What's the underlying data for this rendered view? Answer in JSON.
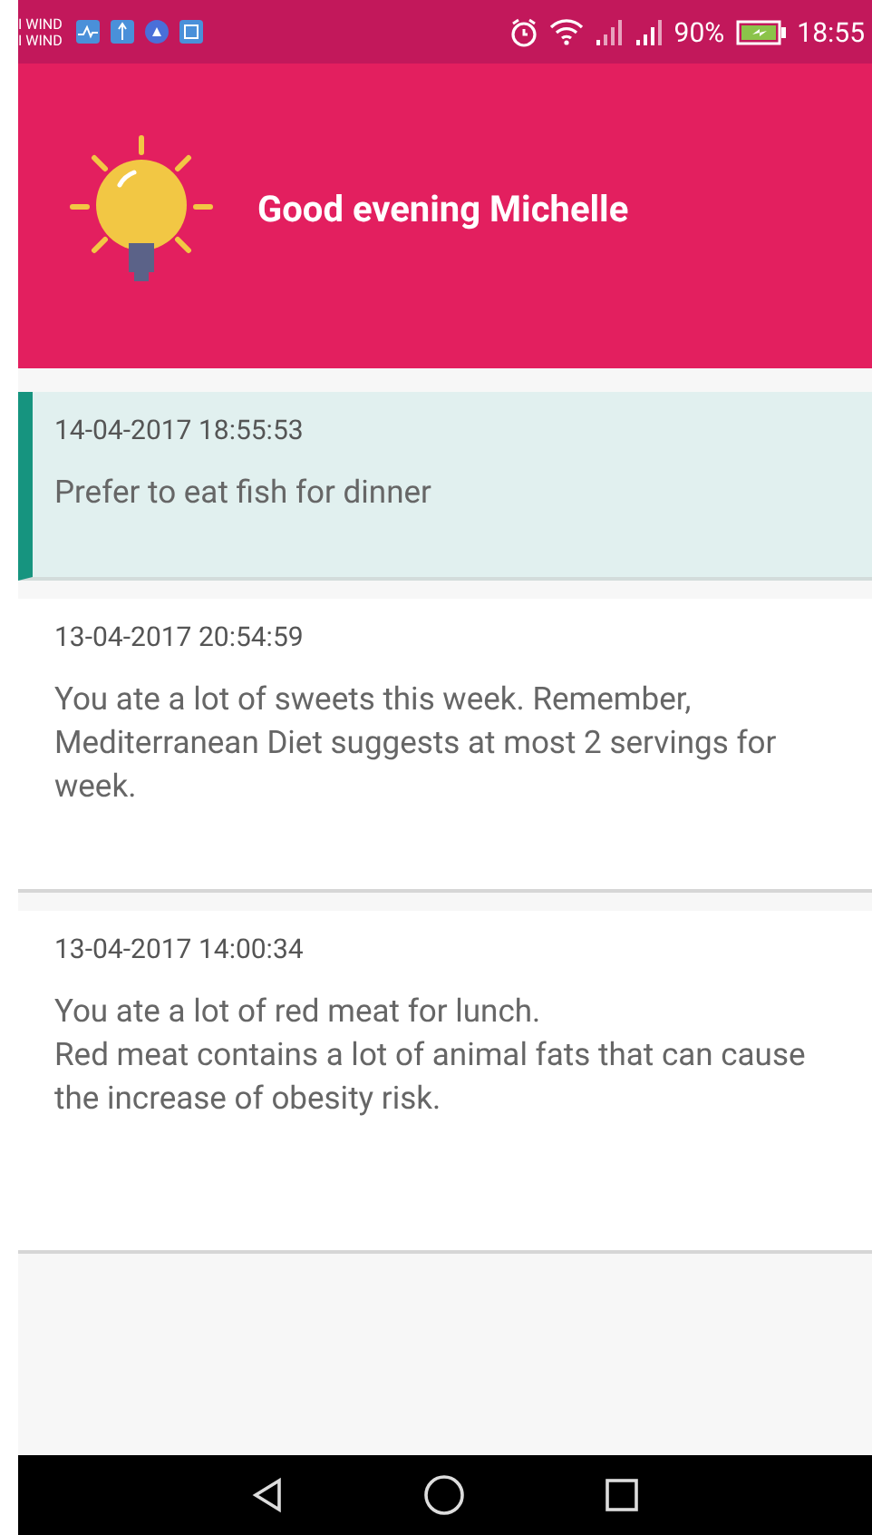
{
  "status_bar": {
    "carriers": [
      "I WIND",
      "I WIND"
    ],
    "battery_percent": "90%",
    "time": "18:55"
  },
  "header": {
    "greeting": "Good evening Michelle"
  },
  "messages": [
    {
      "timestamp": "14-04-2017 18:55:53",
      "text": "Prefer to eat fish for dinner",
      "selected": true
    },
    {
      "timestamp": "13-04-2017 20:54:59",
      "text": "You ate a lot of sweets this week. Remember, Mediterranean Diet suggests at most 2 servings for week.",
      "selected": false
    },
    {
      "timestamp": "13-04-2017 14:00:34",
      "text": "You ate a lot of  red meat for lunch.\nRed meat contains a lot of animal fats that can cause the increase of obesity risk.",
      "selected": false
    }
  ]
}
